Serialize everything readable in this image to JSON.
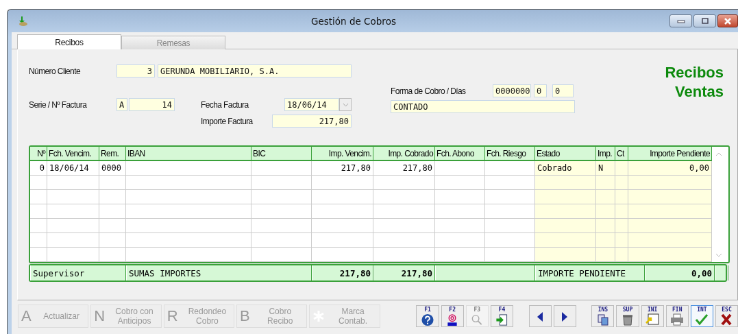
{
  "window": {
    "title": "Gestión de Cobros"
  },
  "tabs": [
    {
      "label": "Recibos",
      "selected": true
    },
    {
      "label": "Remesas",
      "selected": false
    }
  ],
  "heading": [
    "Recibos",
    "Ventas"
  ],
  "form": {
    "cliente_label": "Número Cliente",
    "cliente_numero": "3",
    "cliente_nombre": "GERUNDA MOBILIARIO, S.A.",
    "serie_label": "Serie / Nº Factura",
    "serie": "A",
    "numero_factura": "14",
    "fecha_label": "Fecha Factura",
    "fecha": "18/06/14",
    "importe_label": "Importe Factura",
    "importe": "217,80",
    "forma_label": "Forma de Cobro / Días",
    "forma_codigo": "0000000",
    "dias_1": "0",
    "dias_2": "0",
    "forma_nombre": "CONTADO"
  },
  "table": {
    "columns": [
      "Nº",
      "Fch. Vencim.",
      "Rem.",
      "IBAN",
      "BIC",
      "Imp. Vencim.",
      "Imp. Cobrado",
      "Fch. Abono",
      "Fch. Riesgo",
      "Estado",
      "Imp.",
      "Ct",
      "Importe Pendiente"
    ],
    "rows": [
      {
        "no": "0",
        "fch_vencim": "18/06/14",
        "rem": "0000",
        "imp_vencim": "217,80",
        "imp_cobrado": "217,80",
        "estado": "Cobrado",
        "imp": "N",
        "importe_pendiente": "0,00"
      }
    ],
    "footer": {
      "user": "Supervisor",
      "sum_label": "SUMAS IMPORTES",
      "sum_vencim": "217,80",
      "sum_cobrado": "217,80",
      "pending_label": "IMPORTE PENDIENTE",
      "pending": "0,00"
    }
  },
  "actions": [
    {
      "key": "A",
      "label": "Actualizar",
      "disabled": true
    },
    {
      "key": "N",
      "label": "Cobro con Anticipos",
      "disabled": true
    },
    {
      "key": "R",
      "label": "Redondeo Cobro",
      "disabled": true
    },
    {
      "key": "B",
      "label": "Cobro Recibo",
      "disabled": true
    },
    {
      "kind": "star",
      "label": "Marca Contab.",
      "disabled": true
    }
  ],
  "function_keys": [
    {
      "key": "F1",
      "kind": "help",
      "disabled": false
    },
    {
      "key": "F2",
      "kind": "fax",
      "disabled": false
    },
    {
      "key": "F3",
      "kind": "search",
      "disabled": true
    },
    {
      "key": "F4",
      "kind": "export",
      "disabled": false
    }
  ],
  "nav_keys": [
    {
      "kind": "prev"
    },
    {
      "kind": "next"
    }
  ],
  "command_keys": [
    {
      "key": "INS",
      "kind": "copy",
      "selected": false
    },
    {
      "key": "SUP",
      "kind": "trash",
      "selected": false
    },
    {
      "key": "INI",
      "kind": "window",
      "selected": false
    },
    {
      "key": "FIN",
      "kind": "print",
      "selected": false
    },
    {
      "key": "INT",
      "kind": "check",
      "selected": true
    },
    {
      "key": "ESC",
      "kind": "cross",
      "selected": false
    }
  ]
}
